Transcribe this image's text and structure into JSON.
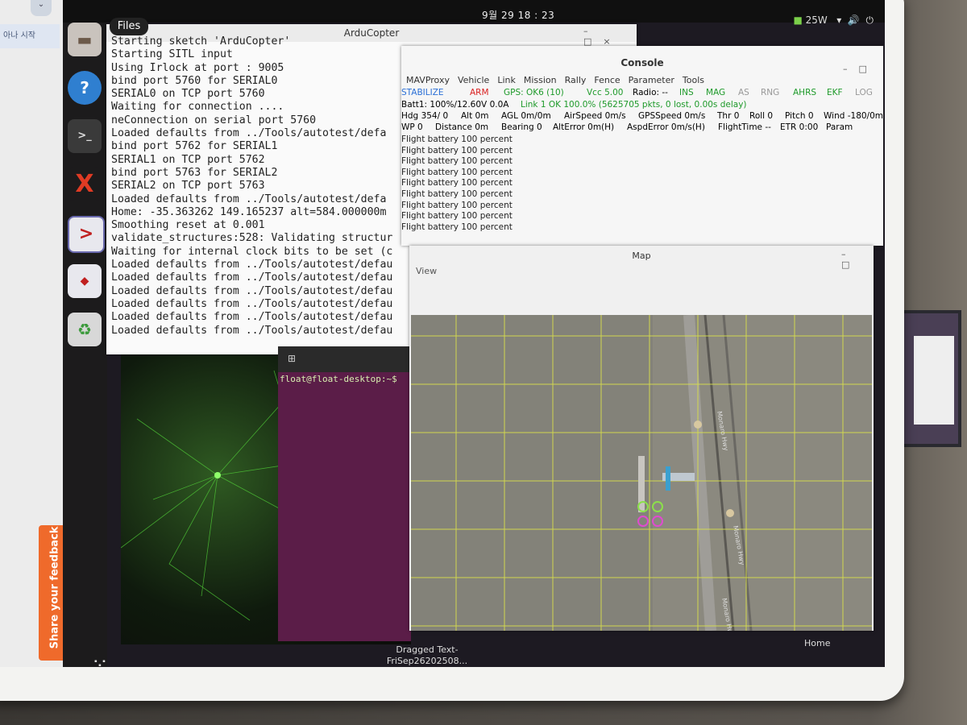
{
  "topbar": {
    "clock": "9월 29  18 : 23",
    "power": "25W"
  },
  "browser": {
    "tab_label": "아나 시작",
    "feedback_label": "Share your feedback"
  },
  "dock": {
    "files_tooltip": "Files",
    "items": [
      "Files",
      "Help",
      "Terminal",
      "XCTU",
      "MAV Console",
      "MAV Map",
      "Trash"
    ]
  },
  "arducopter": {
    "title": "ArduCopter",
    "lines": [
      "Starting sketch 'ArduCopter'",
      "Starting SITL input",
      "Using Irlock at port : 9005",
      "bind port 5760 for SERIAL0",
      "SERIAL0 on TCP port 5760",
      "Waiting for connection ....",
      "neConnection on serial port 5760",
      "Loaded defaults from ../Tools/autotest/defa",
      "bind port 5762 for SERIAL1",
      "SERIAL1 on TCP port 5762",
      "bind port 5763 for SERIAL2",
      "SERIAL2 on TCP port 5763",
      "Loaded defaults from ../Tools/autotest/defa",
      "Home: -35.363262 149.165237 alt=584.000000m",
      "Smoothing reset at 0.001",
      "validate_structures:528: Validating structur",
      "Waiting for internal clock bits to be set (c",
      "Loaded defaults from ../Tools/autotest/defau",
      "Loaded defaults from ../Tools/autotest/defau",
      "Loaded defaults from ../Tools/autotest/defau",
      "Loaded defaults from ../Tools/autotest/defau",
      "Loaded defaults from ../Tools/autotest/defau",
      "Loaded defaults from ../Tools/autotest/defau"
    ]
  },
  "console": {
    "title": "Console",
    "menu": [
      "MAVProxy",
      "Vehicle",
      "Link",
      "Mission",
      "Rally",
      "Fence",
      "Parameter",
      "Tools"
    ],
    "row1": {
      "mode": "STABILIZE",
      "arm": "ARM",
      "gps": "GPS: OK6 (10)",
      "vcc": "Vcc 5.00",
      "radio": "Radio: --",
      "ins": "INS",
      "mag": "MAG",
      "as": "AS",
      "rng": "RNG",
      "ahrs": "AHRS",
      "ekf": "EKF",
      "log": "LOG"
    },
    "row2": {
      "batt": "Batt1: 100%/12.60V 0.0A",
      "link": "Link 1 OK 100.0% (5625705 pkts, 0 lost, 0.00s delay)"
    },
    "row3": {
      "hdg": "Hdg 354/ 0",
      "alt": "Alt 0m",
      "agl": "AGL 0m/0m",
      "airspeed": "AirSpeed 0m/s",
      "gpsspeed": "GPSSpeed 0m/s",
      "thr": "Thr 0",
      "roll": "Roll 0",
      "pitch": "Pitch 0",
      "wind": "Wind -180/0m"
    },
    "row4": {
      "wp": "WP 0",
      "distance": "Distance 0m",
      "bearing": "Bearing 0",
      "alterror": "AltError 0m(H)",
      "aspderror": "AspdError 0m/s(H)",
      "flighttime": "FlightTime --",
      "etr": "ETR 0:00",
      "param": "Param"
    },
    "log": [
      "Flight battery 100 percent",
      "Flight battery 100 percent",
      "Flight battery 100 percent",
      "Flight battery 100 percent",
      "Flight battery 100 percent",
      "Flight battery 100 percent",
      "Flight battery 100 percent",
      "Flight battery 100 percent",
      "Flight battery 100 percent"
    ],
    "colors": {
      "mode": "#2a6fd6",
      "arm": "#d92020",
      "ok": "#1e9a2a",
      "muted": "#999999"
    }
  },
  "map": {
    "title": "Map",
    "menu": "View",
    "road_labels": [
      "Monaro Hwy",
      "Monaro Hwy",
      "Monaro Hw"
    ],
    "home_label": "Home"
  },
  "terminal2": {
    "prompt": "float@float-desktop:~$"
  },
  "dragged": {
    "line1": "Dragged Text-",
    "line2": "FriSep26202508..."
  }
}
